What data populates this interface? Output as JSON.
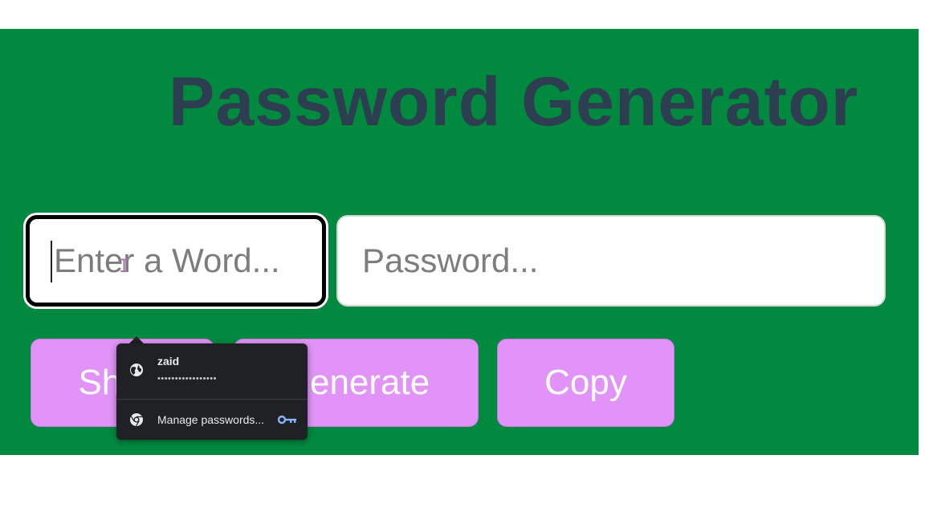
{
  "page": {
    "title": "Password Generator"
  },
  "inputs": {
    "word_placeholder": "Enter a Word...",
    "password_placeholder": "Password..."
  },
  "buttons": {
    "show": "Show",
    "generate": "Generate",
    "copy": "Copy"
  },
  "autofill_popup": {
    "username": "zaid",
    "password_mask": "•••••••••••••••••",
    "manage_label": "Manage passwords...",
    "icons": [
      "globe-icon",
      "chrome-icon",
      "key-icon"
    ]
  },
  "colors": {
    "app_background": "#018a3f",
    "title": "#2c3e50",
    "button": "#e193f7",
    "popup_background": "#202124"
  }
}
